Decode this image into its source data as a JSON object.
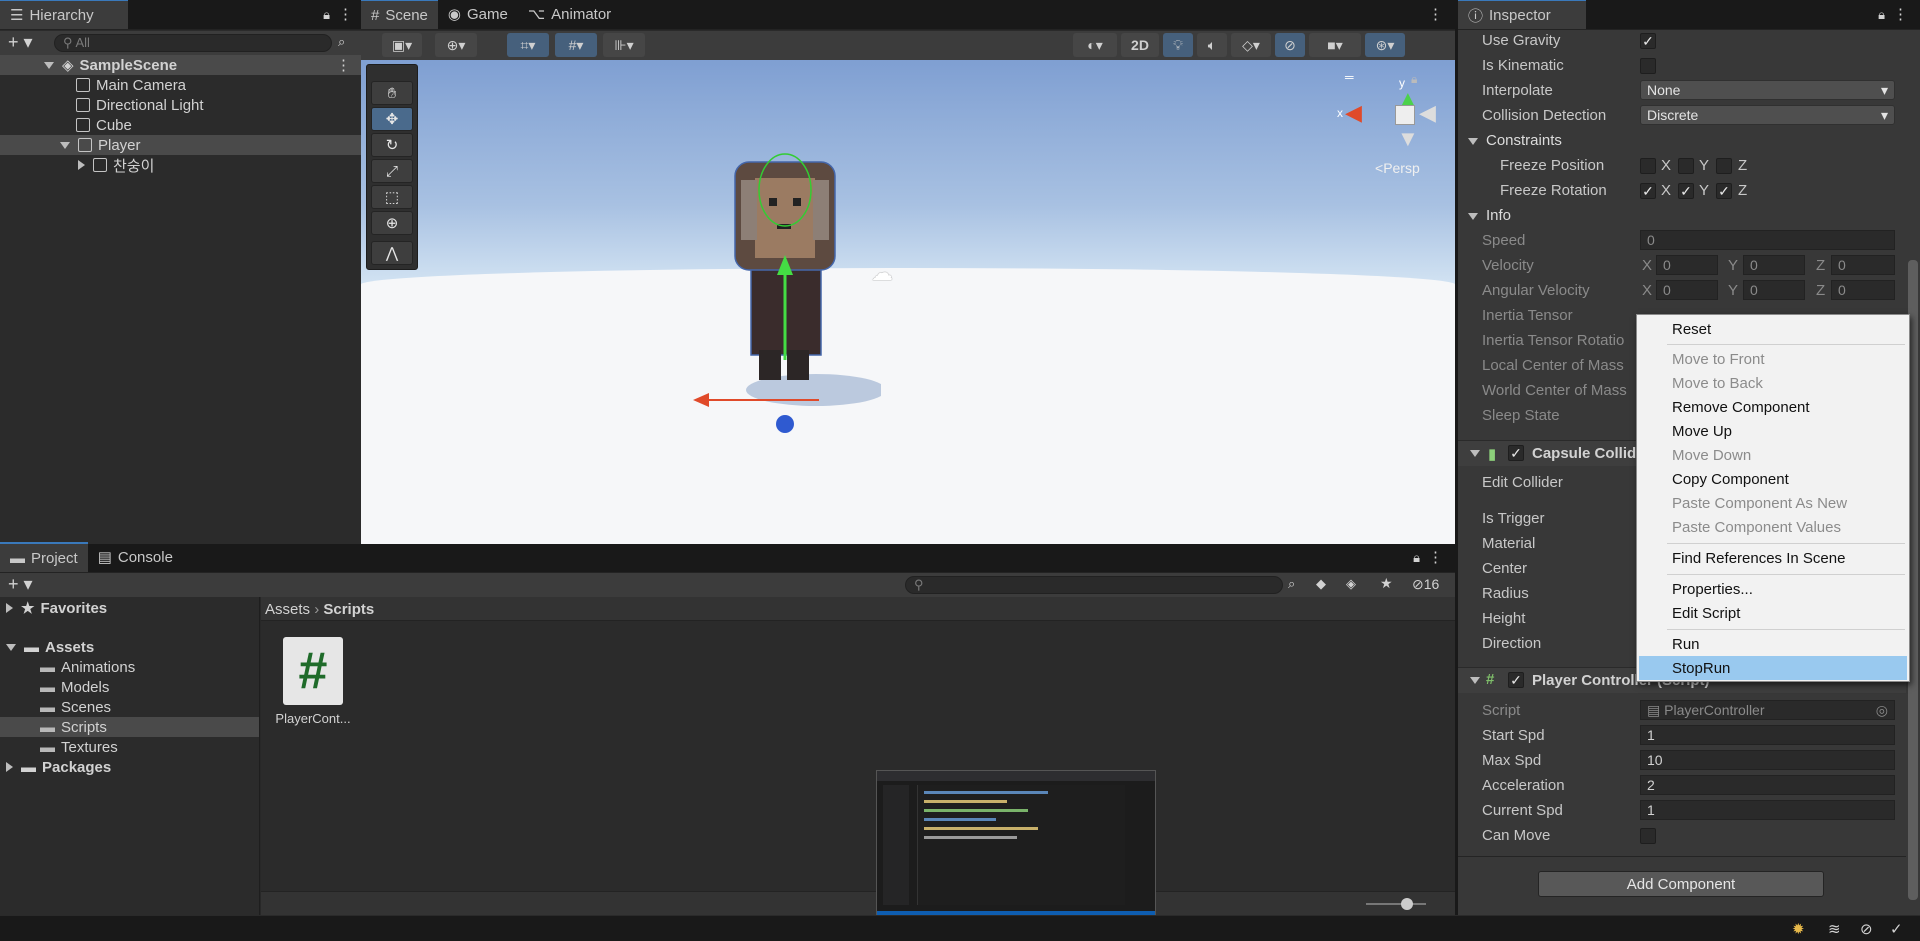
{
  "hierarchy": {
    "tab": "Hierarchy",
    "search_placeholder": "All",
    "scene": "SampleScene",
    "items": [
      "Main Camera",
      "Directional Light",
      "Cube",
      "Player",
      "찬숭이"
    ]
  },
  "scene_tabs": [
    "Scene",
    "Game",
    "Animator"
  ],
  "scene_view": {
    "mode_2d": "2D",
    "persp_label": "Persp",
    "gizmo_y": "y",
    "gizmo_x": "x"
  },
  "project": {
    "tabs": [
      "Project",
      "Console"
    ],
    "tree": {
      "favorites": "Favorites",
      "assets": "Assets",
      "folders": [
        "Animations",
        "Models",
        "Scenes",
        "Scripts",
        "Textures"
      ],
      "packages": "Packages"
    },
    "breadcrumb": [
      "Assets",
      "Scripts"
    ],
    "file_label": "PlayerCont...",
    "hidden_count": "16"
  },
  "inspector": {
    "tab": "Inspector",
    "rigidbody": {
      "use_gravity": "Use Gravity",
      "is_kinematic": "Is Kinematic",
      "interpolate": "Interpolate",
      "interpolate_value": "None",
      "collision_detection": "Collision Detection",
      "collision_value": "Discrete",
      "constraints": "Constraints",
      "freeze_position": "Freeze Position",
      "freeze_rotation": "Freeze Rotation",
      "x": "X",
      "y": "Y",
      "z": "Z",
      "info": "Info",
      "speed": "Speed",
      "speed_value": "0",
      "velocity": "Velocity",
      "angular_velocity": "Angular Velocity",
      "inertia_tensor": "Inertia Tensor",
      "inertia_tensor_rotation": "Inertia Tensor Rotatio",
      "local_center": "Local Center of Mass",
      "world_center": "World Center of Mass",
      "sleep_state": "Sleep State",
      "zero": "0"
    },
    "capsule": {
      "title": "Capsule Collid",
      "edit_collider": "Edit Collider",
      "is_trigger": "Is Trigger",
      "material": "Material",
      "center": "Center",
      "radius": "Radius",
      "height": "Height",
      "direction": "Direction"
    },
    "player_controller": {
      "title": "Player Controller (Script)",
      "script": "Script",
      "script_value": "PlayerController",
      "start_spd": "Start Spd",
      "start_spd_value": "1",
      "max_spd": "Max Spd",
      "max_spd_value": "10",
      "acceleration": "Acceleration",
      "acceleration_value": "2",
      "current_spd": "Current Spd",
      "current_spd_value": "1",
      "can_move": "Can Move"
    },
    "add_component": "Add Component"
  },
  "context_menu": {
    "items": [
      "Reset",
      "Move to Front",
      "Move to Back",
      "Remove Component",
      "Move Up",
      "Move Down",
      "Copy Component",
      "Paste Component As New",
      "Paste Component Values",
      "Find References In Scene",
      "Properties...",
      "Edit Script",
      "Run",
      "StopRun"
    ],
    "highlighted": "StopRun"
  }
}
